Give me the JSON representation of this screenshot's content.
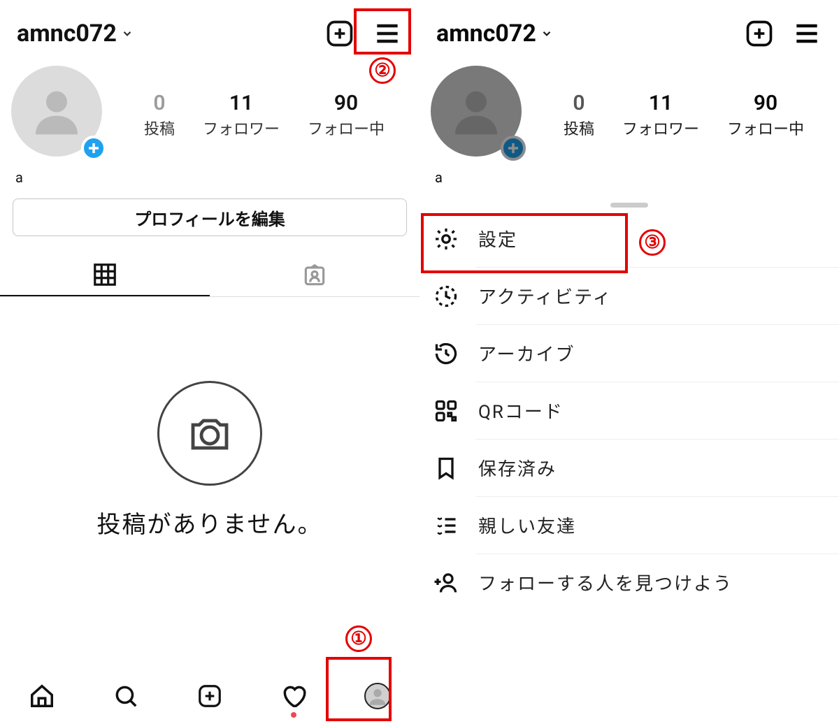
{
  "left": {
    "header": {
      "username": "amnc072"
    },
    "stats": {
      "posts": {
        "value": "0",
        "label": "投稿"
      },
      "followers": {
        "value": "11",
        "label": "フォロワー"
      },
      "following": {
        "value": "90",
        "label": "フォロー中"
      }
    },
    "display_name": "a",
    "edit_profile_label": "プロフィールを編集",
    "empty_text": "投稿がありません。"
  },
  "right": {
    "header": {
      "username": "amnc072"
    },
    "stats": {
      "posts": {
        "value": "0",
        "label": "投稿"
      },
      "followers": {
        "value": "11",
        "label": "フォロワー"
      },
      "following": {
        "value": "90",
        "label": "フォロー中"
      }
    },
    "display_name": "a",
    "sheet_items": [
      {
        "icon": "gear",
        "label": "設定"
      },
      {
        "icon": "activity",
        "label": "アクティビティ"
      },
      {
        "icon": "archive",
        "label": "アーカイブ"
      },
      {
        "icon": "qr",
        "label": "QRコード"
      },
      {
        "icon": "bookmark",
        "label": "保存済み"
      },
      {
        "icon": "close-list",
        "label": "親しい友達"
      },
      {
        "icon": "discover",
        "label": "フォローする人を見つけよう"
      }
    ]
  },
  "annotations": {
    "one": "①",
    "two": "②",
    "three": "③"
  }
}
